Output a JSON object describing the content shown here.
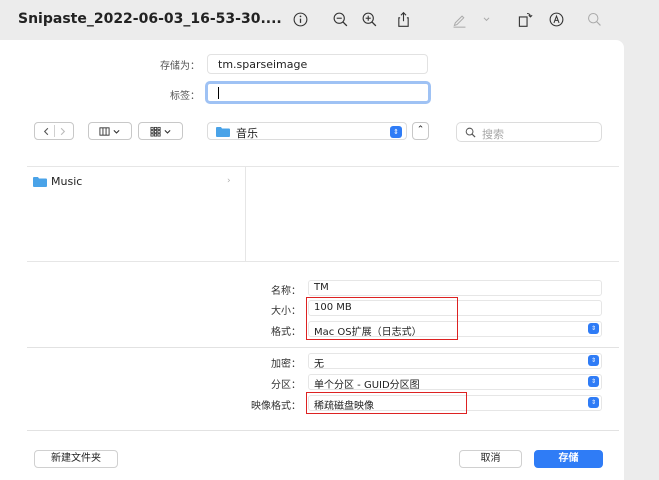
{
  "window": {
    "title": "Snipaste_2022-06-03_16-53-30...."
  },
  "form": {
    "save_as_label": "存储为：",
    "save_as_value": "tm.sparseimage",
    "tags_label": "标签：",
    "location": "音乐",
    "search_placeholder": "搜索"
  },
  "browser": {
    "item": "Music"
  },
  "options": {
    "name_label": "名称：",
    "name_value": "TM",
    "size_label": "大小：",
    "size_value": "100 MB",
    "format_label": "格式：",
    "format_value": "Mac OS扩展（日志式）",
    "encryption_label": "加密：",
    "encryption_value": "无",
    "partition_label": "分区：",
    "partition_value": "单个分区 - GUID分区图",
    "image_format_label": "映像格式：",
    "image_format_value": "稀疏磁盘映像"
  },
  "buttons": {
    "new_folder": "新建文件夹",
    "cancel": "取消",
    "save": "存储"
  },
  "colors": {
    "accent": "#2f7cf6",
    "highlight": "#d22222",
    "folder": "#4aa3e8"
  }
}
